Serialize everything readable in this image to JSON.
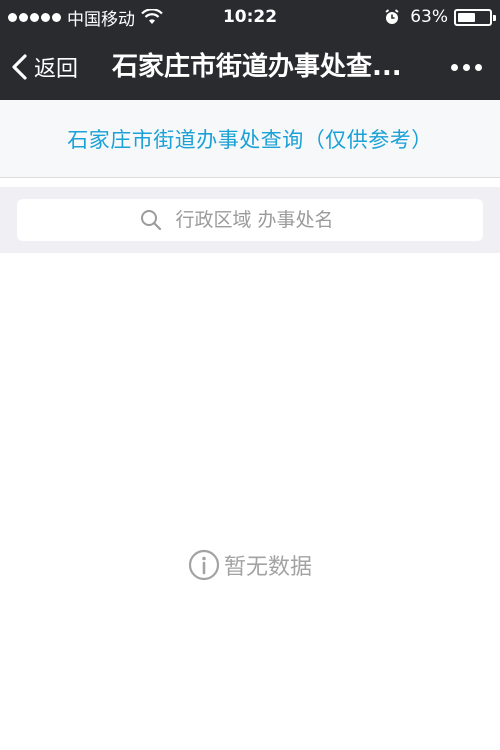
{
  "status_bar": {
    "carrier": "中国移动",
    "time": "10:22",
    "battery_percent": "63%",
    "battery_level": 0.63,
    "signal_icon": "signal-dots-icon",
    "wifi_icon": "wifi-icon",
    "alarm_icon": "alarm-icon"
  },
  "nav": {
    "back_label": "返回",
    "title": "石家庄市街道办事处查...",
    "back_icon": "chevron-left-icon",
    "more_icon": "more-dots-icon"
  },
  "header": {
    "heading": "石家庄市街道办事处查询（仅供参考）",
    "accent_color": "#1aa1d6"
  },
  "search": {
    "placeholder": "行政区域 办事处名",
    "value": "",
    "icon": "search-icon"
  },
  "empty_state": {
    "icon": "info-icon",
    "message": "暂无数据"
  },
  "colors": {
    "bar_background": "#2a2b2f",
    "search_area_background": "#efeff4"
  }
}
